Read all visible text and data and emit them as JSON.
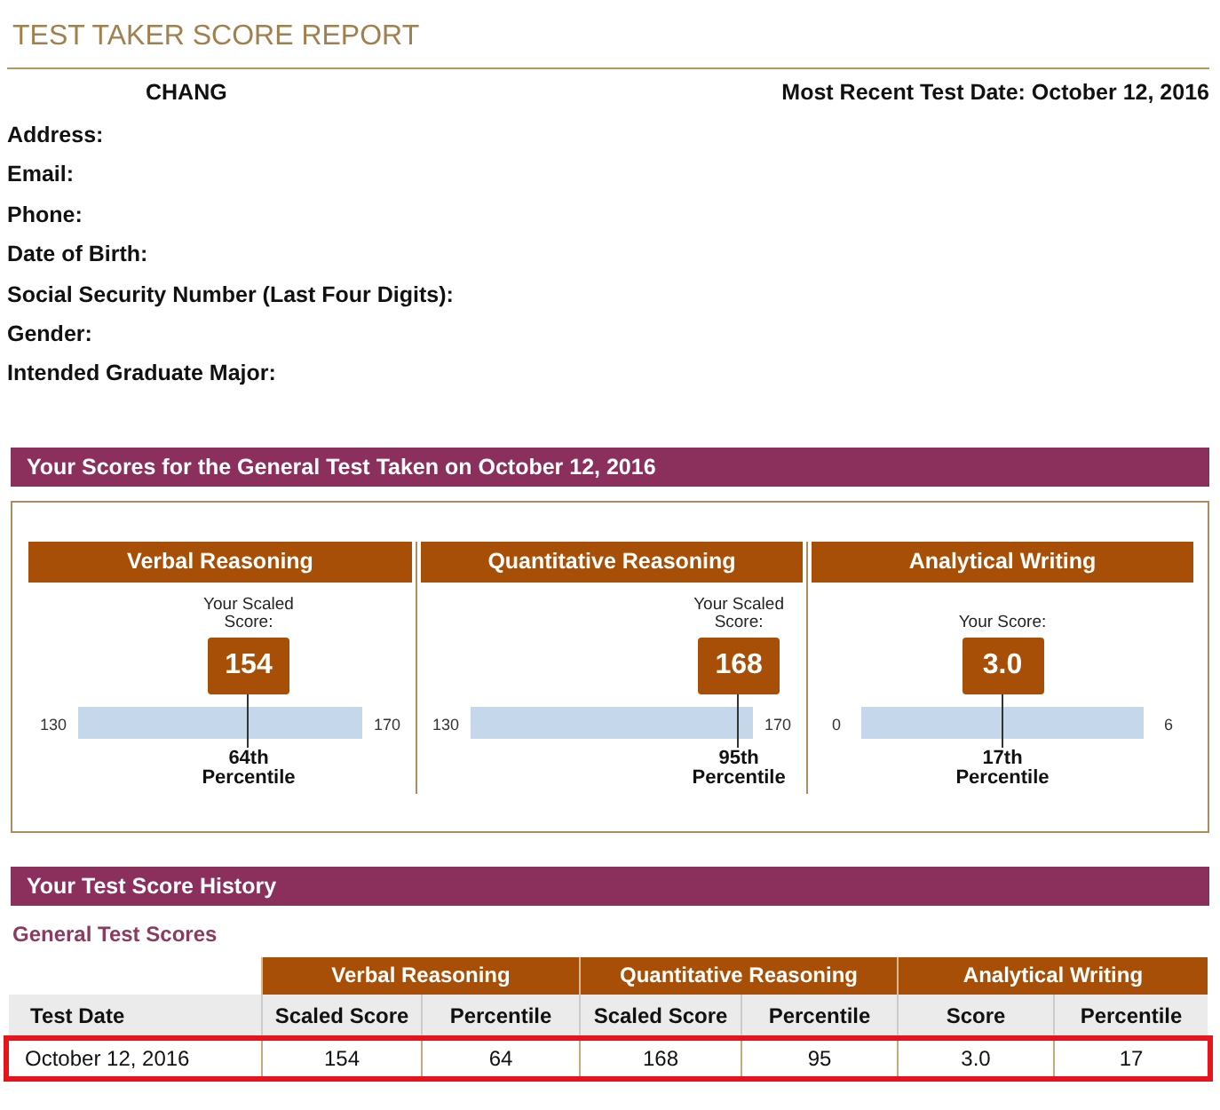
{
  "title": "TEST TAKER SCORE REPORT",
  "name": "CHANG",
  "recent_test": "Most Recent Test Date: October 12, 2016",
  "fields": [
    "Address:",
    "Email:",
    "Phone:",
    "Date of Birth:",
    "Social Security Number (Last Four Digits):",
    "Gender:",
    "Intended Graduate Major:"
  ],
  "scores_heading": "Your Scores for the General Test Taken on October 12, 2016",
  "scores": [
    {
      "label": "Verbal Reasoning",
      "caption": "Your Scaled Score:",
      "score": "154",
      "min": "130",
      "max": "170",
      "level": 0.6,
      "percentile": "64th Percentile"
    },
    {
      "label": "Quantitative Reasoning",
      "caption": "Your Scaled Score:",
      "score": "168",
      "min": "130",
      "max": "170",
      "level": 0.95,
      "percentile": "95th Percentile"
    },
    {
      "label": "Analytical Writing",
      "caption": "Your Score:",
      "score": "3.0",
      "min": "0",
      "max": "6",
      "level": 0.5,
      "percentile": "17th Percentile"
    }
  ],
  "history_heading": "Your Test Score History",
  "history_subheading": "General Test Scores",
  "history_table": {
    "groups": [
      "Verbal Reasoning",
      "Quantitative Reasoning",
      "Analytical Writing"
    ],
    "columns": [
      "Test Date",
      "Scaled Score",
      "Percentile",
      "Scaled Score",
      "Percentile",
      "Score",
      "Percentile"
    ],
    "rows": [
      {
        "highlighted": true,
        "cells": [
          "October 12, 2016",
          "154",
          "64",
          "168",
          "95",
          "3.0",
          "17"
        ]
      }
    ]
  }
}
